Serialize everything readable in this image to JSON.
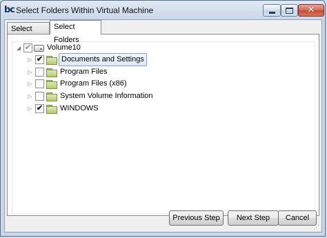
{
  "window": {
    "title": "Select Folders Within Virtual Machine",
    "app_icon_text": "bc",
    "close_glyph": "✕"
  },
  "tabs": [
    {
      "label": "Select Disk",
      "active": false
    },
    {
      "label": "Select Folders",
      "active": true
    }
  ],
  "tree": {
    "root": {
      "label": "Volume10",
      "checked": true,
      "expanded": true,
      "icon": "drive-icon"
    },
    "children": [
      {
        "label": "Documents and Settings",
        "checked": true,
        "selected": true,
        "icon": "folder-icon"
      },
      {
        "label": "Program Files",
        "checked": false,
        "icon": "folder-icon"
      },
      {
        "label": "Program Files (x86)",
        "checked": false,
        "icon": "folder-icon"
      },
      {
        "label": "System Volume Information",
        "checked": false,
        "icon": "folder-icon"
      },
      {
        "label": "WINDOWS",
        "checked": true,
        "icon": "folder-icon"
      }
    ]
  },
  "buttons": {
    "previous": "Previous Step",
    "next": "Next Step",
    "cancel": "Cancel"
  },
  "glyphs": {
    "expanded": "◢",
    "collapsed": "▷",
    "check": "✔"
  }
}
